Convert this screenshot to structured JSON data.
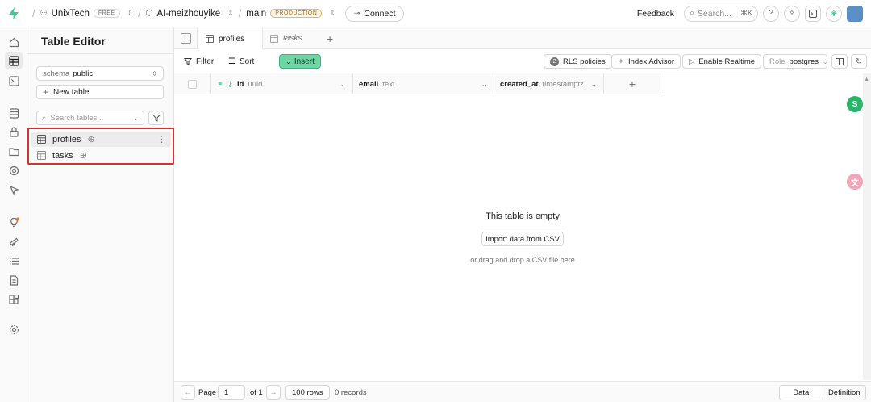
{
  "topbar": {
    "org": "UnixTech",
    "org_badge": "FREE",
    "project": "AI-meizhouyike",
    "branch": "main",
    "branch_badge": "PRODUCTION",
    "connect_label": "Connect",
    "feedback_label": "Feedback",
    "search_placeholder": "Search...",
    "search_kbd": "⌘K"
  },
  "panel": {
    "title": "Table Editor",
    "schema_label": "schema",
    "schema_value": "public",
    "new_table_label": "New table",
    "search_placeholder": "Search tables...",
    "tables": [
      {
        "name": "profiles"
      },
      {
        "name": "tasks"
      }
    ]
  },
  "tabs": [
    {
      "label": "profiles"
    },
    {
      "label": "tasks"
    }
  ],
  "toolbar": {
    "filter_label": "Filter",
    "sort_label": "Sort",
    "insert_label": "Insert",
    "rls_count": "2",
    "rls_label": "RLS policies",
    "index_label": "Index Advisor",
    "realtime_label": "Enable Realtime",
    "role_label": "Role",
    "role_value": "postgres"
  },
  "columns": [
    {
      "name": "id",
      "type": "uuid"
    },
    {
      "name": "email",
      "type": "text"
    },
    {
      "name": "created_at",
      "type": "timestamptz"
    }
  ],
  "empty": {
    "title": "This table is empty",
    "import_label": "Import data from CSV",
    "drag_text": "or drag and drop a CSV file here"
  },
  "footer": {
    "page_label": "Page",
    "page_value": "1",
    "of_label": "of 1",
    "rows_label": "100 rows",
    "records_label": "0 records",
    "data_label": "Data",
    "definition_label": "Definition"
  },
  "colors": {
    "accent": "#3ecf8e",
    "highlight": "#d8312a",
    "production": "#c26a05"
  }
}
